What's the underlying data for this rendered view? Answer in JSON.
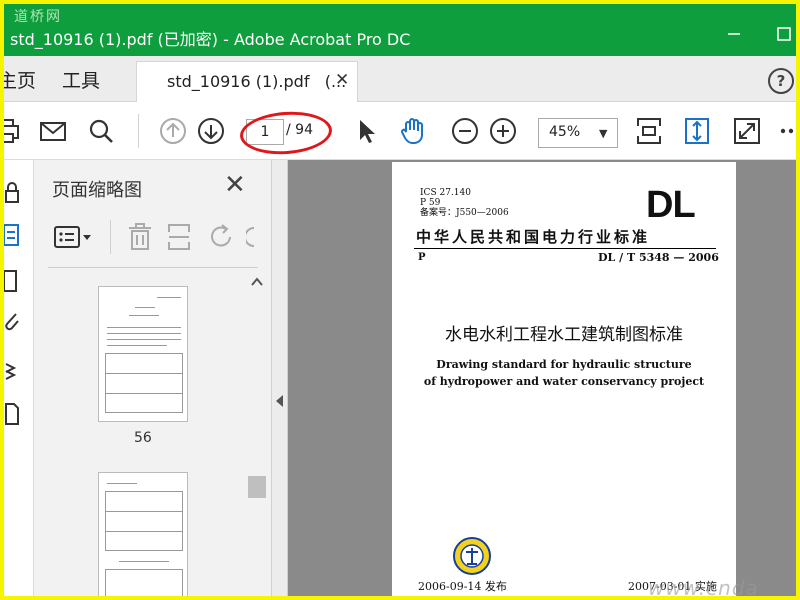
{
  "titlebar": {
    "watermark": "道桥网",
    "title": "std_10916 (1).pdf  (已加密)  - Adobe Acrobat Pro DC",
    "maximize_glyph": "☐"
  },
  "tabs": {
    "home_label": "主页",
    "tools_label": "工具",
    "doc_tab_label": "std_10916 (1).pdf",
    "doc_tab_ellipsis": "(...",
    "close_glyph": "✕",
    "help_glyph": "?"
  },
  "toolbar": {
    "current_page": "1",
    "page_total": "/ 94",
    "zoom": "45%",
    "zoom_caret": "▼",
    "annotation_color": "#e0161b",
    "icons": [
      "print-icon",
      "email-icon",
      "search-icon",
      "page-up-icon",
      "page-down-icon",
      "select-cursor-icon",
      "hand-tool-icon",
      "zoom-out-icon",
      "zoom-in-icon",
      "fit-page-icon",
      "scrolling-mode-icon",
      "fullscreen-icon",
      "more-icon"
    ]
  },
  "thumbnails": {
    "title": "页面缩略图",
    "close_glyph": "✕",
    "pages": [
      {
        "label": "56"
      }
    ]
  },
  "document": {
    "ics_line1": "ICS 27.140",
    "ics_line2": "P 59",
    "ics_line3": "备案号：J550—2006",
    "dl_logo": "DL",
    "standard_title_cn": "中华人民共和国电力行业标准",
    "category": "P",
    "code": "DL / T 5348 — 2006",
    "main_title": "水电水利工程水工建筑制图标准",
    "english_line1": "Drawing standard for hydraulic structure",
    "english_line2": "of hydropower and water conservancy project",
    "publish": "2006-09-14 发布",
    "implement": "2007-03-01 实施"
  },
  "watermark_br": "www.cnda",
  "colors": {
    "titlebar_bg": "#0f9e3e",
    "frame_border": "#f5f500",
    "accent_blue": "#1a73c8"
  }
}
